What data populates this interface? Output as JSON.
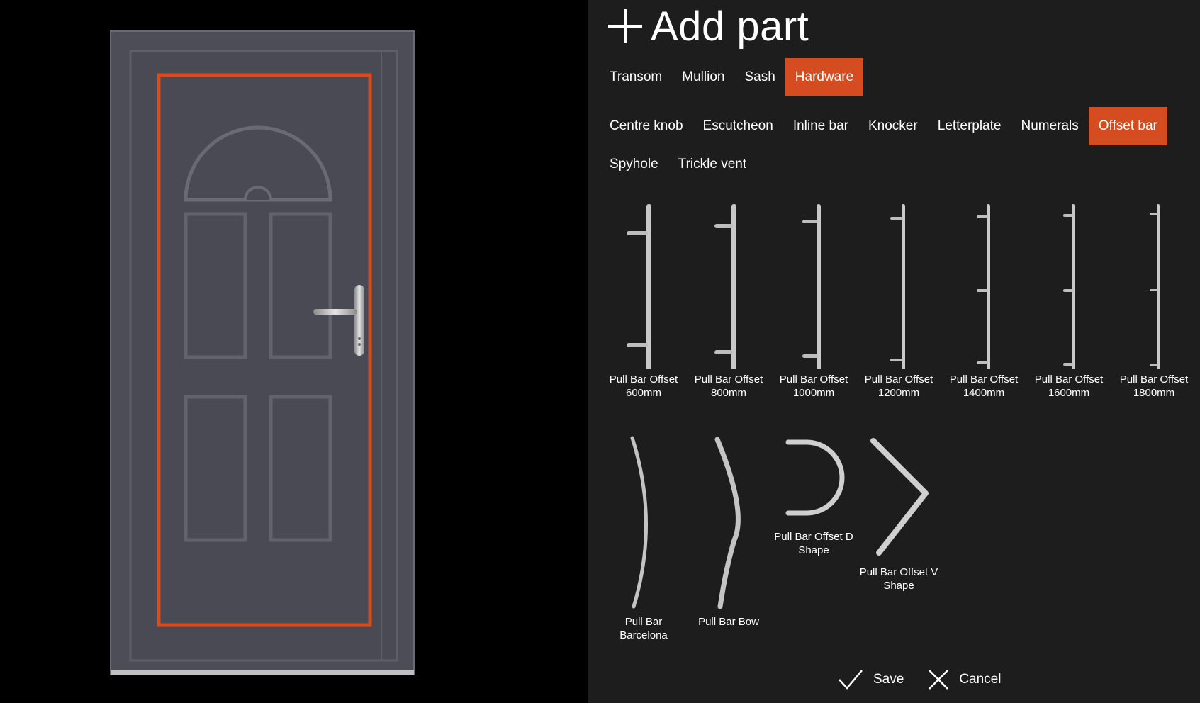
{
  "panel": {
    "title": "Add part",
    "part_tabs": [
      {
        "label": "Transom",
        "active": false
      },
      {
        "label": "Mullion",
        "active": false
      },
      {
        "label": "Sash",
        "active": false
      },
      {
        "label": "Hardware",
        "active": true
      }
    ],
    "hardware_tabs": [
      {
        "label": "Centre knob",
        "active": false
      },
      {
        "label": "Escutcheon",
        "active": false
      },
      {
        "label": "Inline bar",
        "active": false
      },
      {
        "label": "Knocker",
        "active": false
      },
      {
        "label": "Letterplate",
        "active": false
      },
      {
        "label": "Numerals",
        "active": false
      },
      {
        "label": "Offset bar",
        "active": true
      },
      {
        "label": "Spyhole",
        "active": false
      },
      {
        "label": "Trickle vent",
        "active": false
      }
    ],
    "items": [
      {
        "name": "Pull Bar Offset 600mm",
        "icon": "offset-bar-icon"
      },
      {
        "name": "Pull Bar Offset 800mm",
        "icon": "offset-bar-icon"
      },
      {
        "name": "Pull Bar Offset 1000mm",
        "icon": "offset-bar-icon"
      },
      {
        "name": "Pull Bar Offset 1200mm",
        "icon": "offset-bar-icon"
      },
      {
        "name": "Pull Bar Offset 1400mm",
        "icon": "offset-bar-3-leg-icon"
      },
      {
        "name": "Pull Bar Offset 1600mm",
        "icon": "offset-bar-3-leg-icon"
      },
      {
        "name": "Pull Bar Offset 1800mm",
        "icon": "offset-bar-3-leg-icon"
      },
      {
        "name": "Pull Bar Barcelona",
        "icon": "barcelona-bar-icon"
      },
      {
        "name": "Pull Bar Bow",
        "icon": "bow-bar-icon"
      },
      {
        "name": "Pull Bar Offset D Shape",
        "icon": "d-shape-bar-icon"
      },
      {
        "name": "Pull Bar Offset V Shape",
        "icon": "v-shape-bar-icon"
      }
    ],
    "footer": {
      "save_label": "Save",
      "cancel_label": "Cancel"
    }
  },
  "colors": {
    "accent": "#d44c20",
    "panel_bg": "#1d1d1d",
    "door": "#4b4b55",
    "metal": "#c8c8c8"
  }
}
